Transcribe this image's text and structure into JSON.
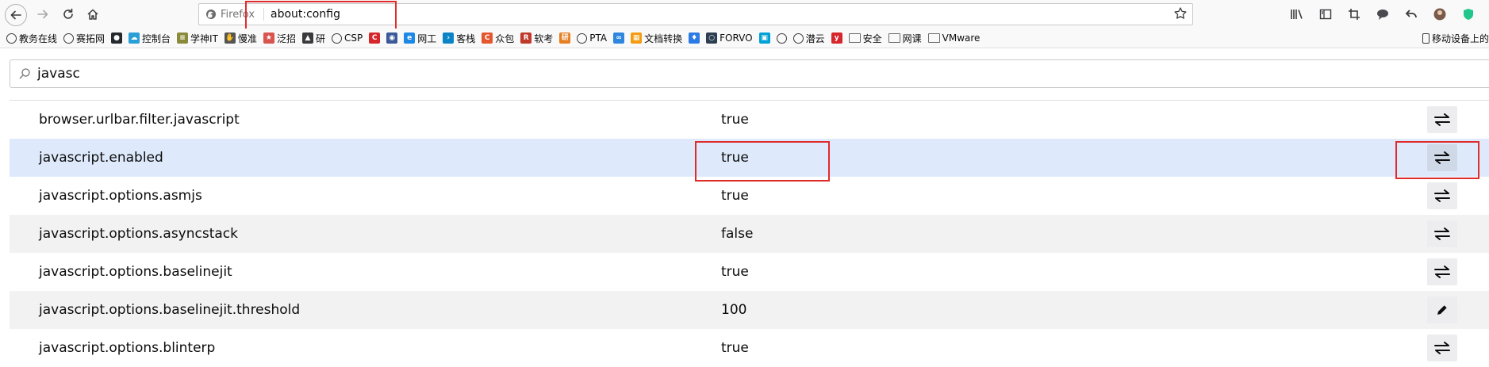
{
  "toolbar": {
    "identity_label": "Firefox",
    "url": "about:config"
  },
  "bookmarks": [
    {
      "label": "教务在线",
      "icon": "globe-icon",
      "color": "#3a3a3c"
    },
    {
      "label": "赛拓网",
      "icon": "globe-icon",
      "color": "#3a3a3c"
    },
    {
      "label": "",
      "icon": "github-icon",
      "color": "#24292e"
    },
    {
      "label": "控制台",
      "icon": "cloud-icon",
      "color": "#2a9fd6"
    },
    {
      "label": "学神IT",
      "icon": "xueshen-icon",
      "color": "#8a8a3a"
    },
    {
      "label": "慢准",
      "icon": "paw-icon",
      "color": "#555555"
    },
    {
      "label": "泛招",
      "icon": "star-icon",
      "color": "#d9534f"
    },
    {
      "label": "研",
      "icon": "graduation-icon",
      "color": "#3a3a3c"
    },
    {
      "label": "CSP",
      "icon": "globe-icon",
      "color": "#3a3a3c"
    },
    {
      "label": "",
      "icon": "c-red-icon",
      "color": "#d7262b"
    },
    {
      "label": "",
      "icon": "eye-icon",
      "color": "#3b5998"
    },
    {
      "label": "网工",
      "icon": "e-icon",
      "color": "#1e88e5"
    },
    {
      "label": "客栈",
      "icon": "terminal-icon",
      "color": "#0a84c6"
    },
    {
      "label": "众包",
      "icon": "c-circle-icon",
      "color": "#e4572e"
    },
    {
      "label": "软考",
      "icon": "r-icon",
      "color": "#c0392b"
    },
    {
      "label": "",
      "icon": "yan-icon",
      "color": "#e67e22"
    },
    {
      "label": "PTA",
      "icon": "globe-icon",
      "color": "#3a3a3c"
    },
    {
      "label": "",
      "icon": "rings-icon",
      "color": "#2e86de"
    },
    {
      "label": "文档转换",
      "icon": "colors-icon",
      "color": "#f39c12"
    },
    {
      "label": "",
      "icon": "badge-icon",
      "color": "#2c7be5"
    },
    {
      "label": "FORVO",
      "icon": "forvo-icon",
      "color": "#2c3e50"
    },
    {
      "label": "",
      "icon": "bilibili-icon",
      "color": "#00a1d6"
    },
    {
      "label": "",
      "icon": "globe-icon",
      "color": "#3a3a3c"
    },
    {
      "label": "潜云",
      "icon": "globe-icon",
      "color": "#3a3a3c"
    },
    {
      "label": "",
      "icon": "y-icon",
      "color": "#d7262b"
    },
    {
      "label": "安全",
      "icon": "folder-icon",
      "color": "#6b6b6b"
    },
    {
      "label": "网课",
      "icon": "folder-icon",
      "color": "#6b6b6b"
    },
    {
      "label": "VMware",
      "icon": "folder-icon",
      "color": "#6b6b6b"
    }
  ],
  "mobile_bookmarks": "移动设备上的",
  "config": {
    "search_value": "javasc",
    "prefs": [
      {
        "name": "browser.urlbar.filter.javascript",
        "value": "true",
        "action": "toggle"
      },
      {
        "name": "javascript.enabled",
        "value": "true",
        "action": "toggle"
      },
      {
        "name": "javascript.options.asmjs",
        "value": "true",
        "action": "toggle"
      },
      {
        "name": "javascript.options.asyncstack",
        "value": "false",
        "action": "toggle"
      },
      {
        "name": "javascript.options.baselinejit",
        "value": "true",
        "action": "toggle"
      },
      {
        "name": "javascript.options.baselinejit.threshold",
        "value": "100",
        "action": "edit"
      },
      {
        "name": "javascript.options.blinterp",
        "value": "true",
        "action": "toggle"
      }
    ]
  },
  "colors": {
    "highlight": "#e02b2b",
    "selected_row": "#deeafb",
    "alt_row": "#f2f2f3"
  }
}
